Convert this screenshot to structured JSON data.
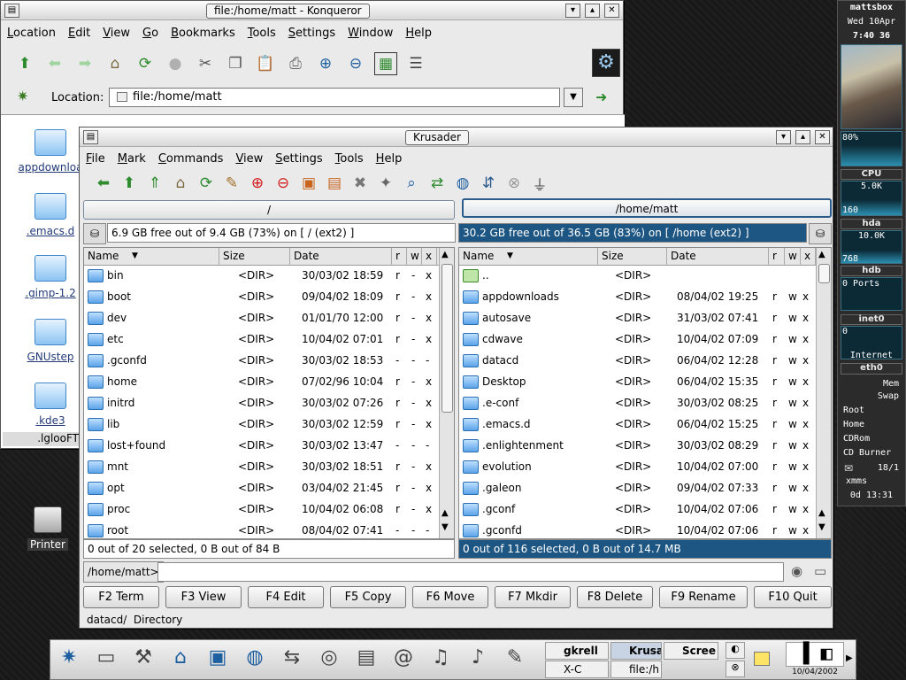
{
  "konqueror": {
    "title": "file:/home/matt - Konqueror",
    "menu": [
      "Location",
      "Edit",
      "View",
      "Go",
      "Bookmarks",
      "Tools",
      "Settings",
      "Window",
      "Help"
    ],
    "location_label": "Location:",
    "location_value": "file:/home/matt",
    "icons": [
      "appdownloa",
      ".emacs.d",
      ".gimp-1.2",
      "GNUstep",
      ".kde3",
      ".lglooFT"
    ]
  },
  "krusader": {
    "title": "Krusader",
    "menu": [
      "File",
      "Mark",
      "Commands",
      "View",
      "Settings",
      "Tools",
      "Help"
    ],
    "left": {
      "path": "/",
      "free": "6.9 GB free out of 9.4 GB (73%) on [ / (ext2) ]",
      "columns": [
        "Name",
        "Size",
        "Date",
        "r",
        "w",
        "x"
      ],
      "rows": [
        {
          "name": "bin",
          "size": "<DIR>",
          "date": "30/03/02 18:59",
          "r": "r",
          "w": "-",
          "x": "x"
        },
        {
          "name": "boot",
          "size": "<DIR>",
          "date": "09/04/02 18:09",
          "r": "r",
          "w": "-",
          "x": "x"
        },
        {
          "name": "dev",
          "size": "<DIR>",
          "date": "01/01/70 12:00",
          "r": "r",
          "w": "-",
          "x": "x"
        },
        {
          "name": "etc",
          "size": "<DIR>",
          "date": "10/04/02 07:01",
          "r": "r",
          "w": "-",
          "x": "x"
        },
        {
          "name": ".gconfd",
          "size": "<DIR>",
          "date": "30/03/02 18:53",
          "r": "-",
          "w": "-",
          "x": "-"
        },
        {
          "name": "home",
          "size": "<DIR>",
          "date": "07/02/96 10:04",
          "r": "r",
          "w": "-",
          "x": "x"
        },
        {
          "name": "initrd",
          "size": "<DIR>",
          "date": "30/03/02 07:26",
          "r": "r",
          "w": "-",
          "x": "x"
        },
        {
          "name": "lib",
          "size": "<DIR>",
          "date": "30/03/02 12:59",
          "r": "r",
          "w": "-",
          "x": "x"
        },
        {
          "name": "lost+found",
          "size": "<DIR>",
          "date": "30/03/02 13:47",
          "r": "-",
          "w": "-",
          "x": "-"
        },
        {
          "name": "mnt",
          "size": "<DIR>",
          "date": "30/03/02 18:51",
          "r": "r",
          "w": "-",
          "x": "x"
        },
        {
          "name": "opt",
          "size": "<DIR>",
          "date": "03/04/02 21:45",
          "r": "r",
          "w": "-",
          "x": "x"
        },
        {
          "name": "proc",
          "size": "<DIR>",
          "date": "10/04/02 06:08",
          "r": "r",
          "w": "-",
          "x": "x"
        },
        {
          "name": "root",
          "size": "<DIR>",
          "date": "08/04/02 07:41",
          "r": "-",
          "w": "-",
          "x": "-"
        }
      ],
      "status": "0 out of 20 selected, 0 B out of 84 B"
    },
    "right": {
      "path": "/home/matt",
      "free": "30.2 GB free out of 36.5 GB (83%) on [ /home (ext2) ]",
      "columns": [
        "Name",
        "Size",
        "Date",
        "r",
        "w",
        "x"
      ],
      "rows": [
        {
          "name": "..",
          "size": "<DIR>",
          "date": "",
          "r": "",
          "w": "",
          "x": ""
        },
        {
          "name": "appdownloads",
          "size": "<DIR>",
          "date": "08/04/02 19:25",
          "r": "r",
          "w": "w",
          "x": "x"
        },
        {
          "name": "autosave",
          "size": "<DIR>",
          "date": "31/03/02 07:41",
          "r": "r",
          "w": "w",
          "x": "x"
        },
        {
          "name": "cdwave",
          "size": "<DIR>",
          "date": "10/04/02 07:09",
          "r": "r",
          "w": "w",
          "x": "x"
        },
        {
          "name": "datacd",
          "size": "<DIR>",
          "date": "06/04/02 12:28",
          "r": "r",
          "w": "w",
          "x": "x"
        },
        {
          "name": "Desktop",
          "size": "<DIR>",
          "date": "06/04/02 15:35",
          "r": "r",
          "w": "w",
          "x": "x"
        },
        {
          "name": ".e-conf",
          "size": "<DIR>",
          "date": "30/03/02 08:25",
          "r": "r",
          "w": "w",
          "x": "x"
        },
        {
          "name": ".emacs.d",
          "size": "<DIR>",
          "date": "06/04/02 15:25",
          "r": "r",
          "w": "w",
          "x": "x"
        },
        {
          "name": ".enlightenment",
          "size": "<DIR>",
          "date": "30/03/02 08:29",
          "r": "r",
          "w": "w",
          "x": "x"
        },
        {
          "name": "evolution",
          "size": "<DIR>",
          "date": "10/04/02 07:00",
          "r": "r",
          "w": "w",
          "x": "x"
        },
        {
          "name": ".galeon",
          "size": "<DIR>",
          "date": "09/04/02 07:33",
          "r": "r",
          "w": "w",
          "x": "x"
        },
        {
          "name": ".gconf",
          "size": "<DIR>",
          "date": "10/04/02 07:06",
          "r": "r",
          "w": "w",
          "x": "x"
        },
        {
          "name": ".gconfd",
          "size": "<DIR>",
          "date": "10/04/02 07:06",
          "r": "r",
          "w": "w",
          "x": "x"
        }
      ],
      "status": "0 out of 116 selected, 0 B out of 14.7 MB"
    },
    "command_prompt": "/home/matt>",
    "fkeys": [
      "F2 Term",
      "F3 View",
      "F4 Edit",
      "F5 Copy",
      "F6 Move",
      "F7 Mkdir",
      "F8 Delete",
      "F9 Rename",
      "F10 Quit"
    ],
    "statusbar": "datacd/  Directory"
  },
  "desktop": {
    "printer_label": "Printer"
  },
  "gkrellm": {
    "host": "mattsbox",
    "date": "Wed 10Apr",
    "time": "7:40 36",
    "cpu_pct": "80%",
    "cpu_label": "CPU",
    "hda_top": "5.0K",
    "hda_val": "160",
    "hda_label": "hda",
    "hdb_top": "10.0K",
    "hdb_val": "768",
    "hdb_label": "hdb",
    "ports": "0 Ports",
    "inet_label": "inet0",
    "inet_val": "0",
    "internet_label": "Internet",
    "eth_label": "eth0",
    "mem_label": "Mem",
    "swap_label": "Swap",
    "fs": [
      "Root",
      "Home",
      "CDRom",
      "CD Burner"
    ],
    "mail": "18/1",
    "xmms": "xmms",
    "uptime": "0d 13:31"
  },
  "taskbar": {
    "tasks": [
      "gkrell",
      "Krusa",
      "Scree",
      "X-C",
      "file:/h"
    ],
    "clock_date": "10/04/2002"
  }
}
